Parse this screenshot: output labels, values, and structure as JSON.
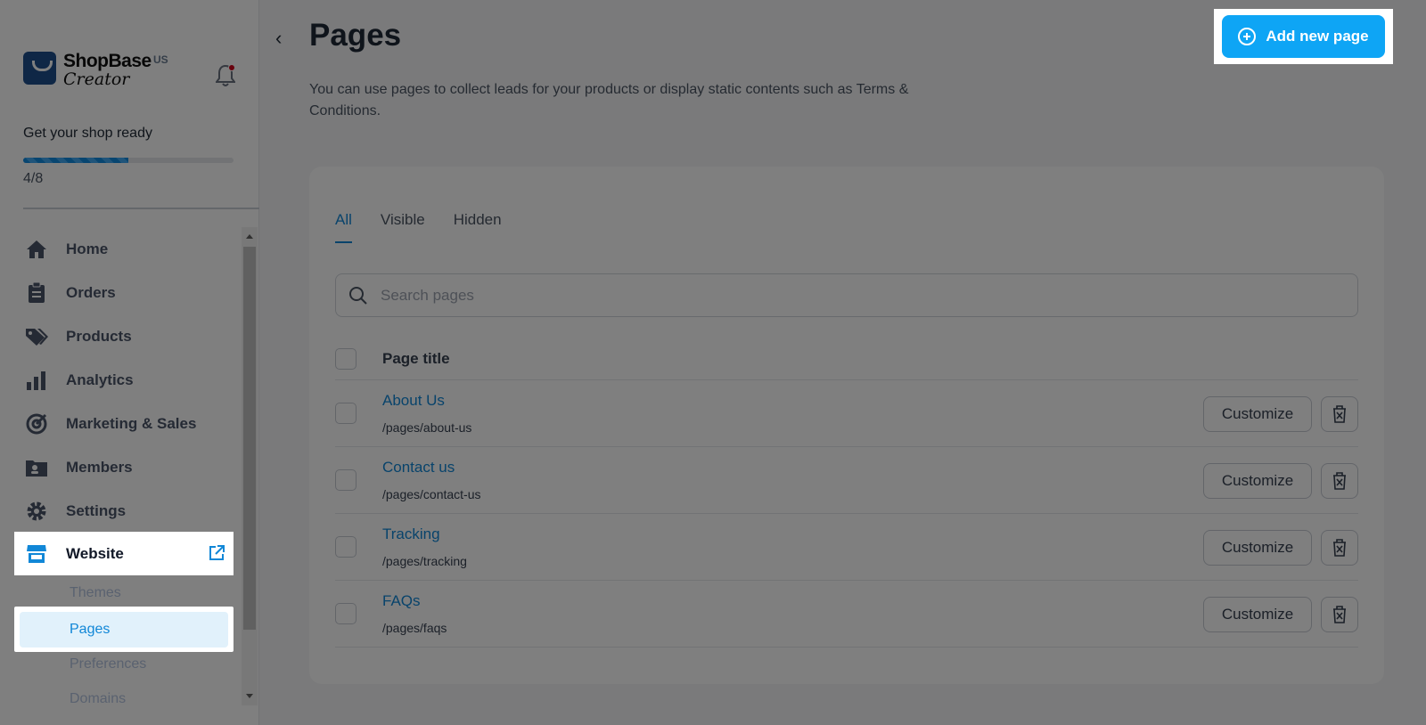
{
  "sidebar": {
    "brand": "ShopBase",
    "brand_sub": "Creator",
    "region": "US",
    "setup": {
      "title": "Get your shop ready",
      "count": "4/8",
      "progress": 0.5
    },
    "nav": [
      {
        "label": "Home",
        "icon": "home-icon"
      },
      {
        "label": "Orders",
        "icon": "clipboard-icon"
      },
      {
        "label": "Products",
        "icon": "tag-icon"
      },
      {
        "label": "Analytics",
        "icon": "bar-chart-icon"
      },
      {
        "label": "Marketing & Sales",
        "icon": "target-icon"
      },
      {
        "label": "Members",
        "icon": "members-folder-icon"
      },
      {
        "label": "Settings",
        "icon": "gear-icon"
      }
    ],
    "website": {
      "label": "Website",
      "icon": "store-icon"
    },
    "subnav": [
      {
        "label": "Themes"
      },
      {
        "label": "Pages"
      },
      {
        "label": "Preferences"
      },
      {
        "label": "Domains"
      }
    ]
  },
  "header": {
    "title": "Pages",
    "description": "You can use pages to collect leads for your products or display static contents such as Terms & Conditions.",
    "add_button": "Add new page"
  },
  "tabs": [
    {
      "label": "All"
    },
    {
      "label": "Visible"
    },
    {
      "label": "Hidden"
    }
  ],
  "search": {
    "placeholder": "Search pages",
    "value": ""
  },
  "table": {
    "header": "Page title",
    "customize_label": "Customize",
    "rows": [
      {
        "title": "About Us",
        "path": "/pages/about-us"
      },
      {
        "title": "Contact us",
        "path": "/pages/contact-us"
      },
      {
        "title": "Tracking",
        "path": "/pages/tracking"
      },
      {
        "title": "FAQs",
        "path": "/pages/faqs"
      }
    ]
  },
  "colors": {
    "accent": "#1187d7",
    "primary_button": "#0ea5f5",
    "overlay": "rgba(0,0,0,0.5)"
  }
}
